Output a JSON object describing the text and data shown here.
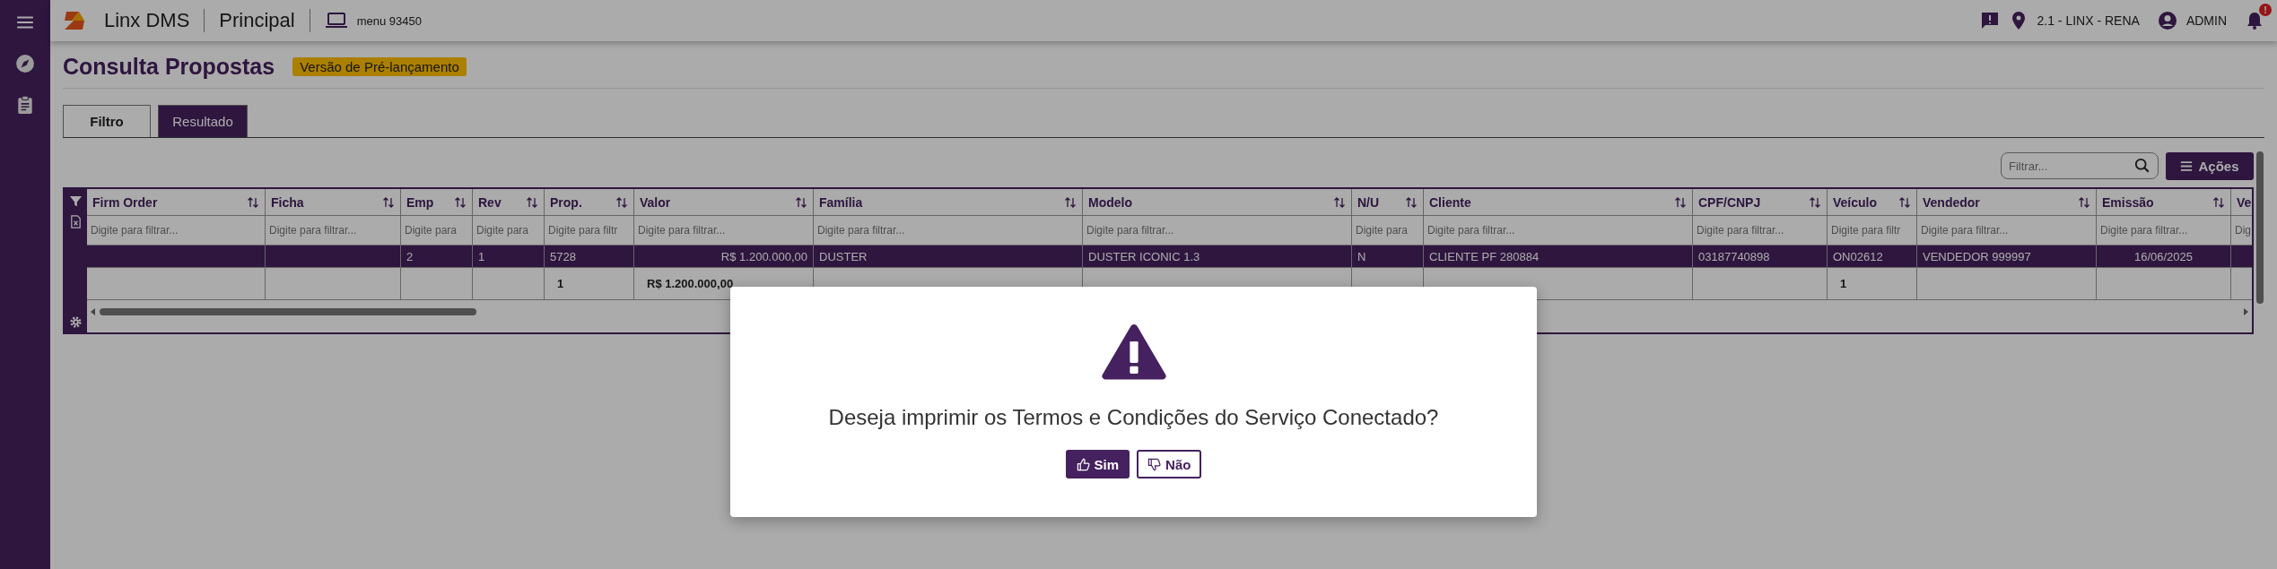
{
  "header": {
    "brand": "Linx DMS",
    "module": "Principal",
    "menu": "menu 93450",
    "location": "2.1 - LINX - RENA",
    "user": "ADMIN",
    "notification_badge": "!"
  },
  "page": {
    "title": "Consulta Propostas",
    "badge": "Versão de Pré-lançamento"
  },
  "tabs": [
    {
      "label": "Filtro",
      "selected": false
    },
    {
      "label": "Resultado",
      "selected": true
    }
  ],
  "search": {
    "placeholder": "Filtrar..."
  },
  "actions_button": "Ações",
  "table": {
    "columns": [
      {
        "label": "Firm Order",
        "filter_placeholder": "Digite para filtrar..."
      },
      {
        "label": "Ficha",
        "filter_placeholder": "Digite para filtrar..."
      },
      {
        "label": "Emp",
        "filter_placeholder": "Digite para"
      },
      {
        "label": "Rev",
        "filter_placeholder": "Digite para"
      },
      {
        "label": "Prop.",
        "filter_placeholder": "Digite para filtr"
      },
      {
        "label": "Valor",
        "filter_placeholder": "Digite para filtrar..."
      },
      {
        "label": "Família",
        "filter_placeholder": "Digite para filtrar..."
      },
      {
        "label": "Modelo",
        "filter_placeholder": "Digite para filtrar..."
      },
      {
        "label": "N/U",
        "filter_placeholder": "Digite para"
      },
      {
        "label": "Cliente",
        "filter_placeholder": "Digite para filtrar..."
      },
      {
        "label": "CPF/CNPJ",
        "filter_placeholder": "Digite para filtrar..."
      },
      {
        "label": "Veículo",
        "filter_placeholder": "Digite para filtr"
      },
      {
        "label": "Vendedor",
        "filter_placeholder": "Digite para filtrar..."
      },
      {
        "label": "Emissão",
        "filter_placeholder": "Digite para filtrar..."
      },
      {
        "label": "Ve",
        "filter_placeholder": "Dig"
      }
    ],
    "rows": [
      {
        "selected": true,
        "emp": "2",
        "rev": "1",
        "prop": "5728",
        "valor": "R$ 1.200.000,00",
        "familia": "DUSTER",
        "modelo": "DUSTER ICONIC 1.3",
        "nu": "N",
        "cliente": "CLIENTE PF 280884",
        "cpf_cnpj": "03187740898",
        "veiculo": "ON02612",
        "vendedor": "VENDEDOR 999997",
        "emissao": "16/06/2025"
      }
    ],
    "totals": {
      "prop": "1",
      "valor": "R$ 1.200.000,00",
      "veiculo": "1"
    }
  },
  "dialog": {
    "message": "Deseja imprimir os Termos e Condições do Serviço Conectado?",
    "buttons": [
      {
        "label": "Sim",
        "kind": "primary"
      },
      {
        "label": "Não",
        "kind": "secondary"
      }
    ]
  }
}
